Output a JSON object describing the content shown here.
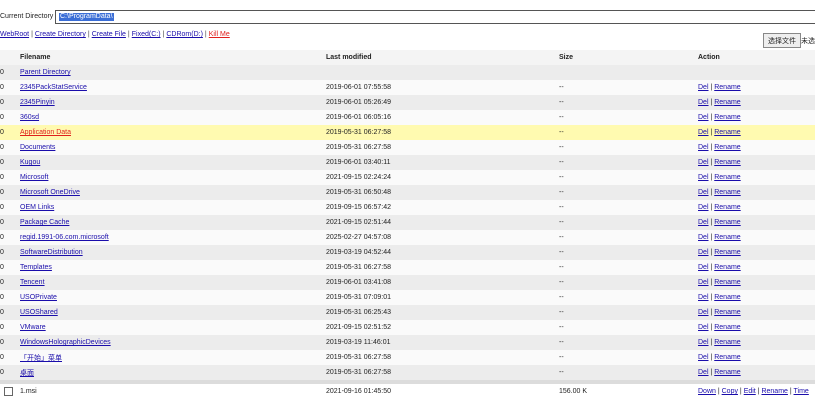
{
  "header": {
    "current_dir_label": "Current Directory :",
    "current_dir_value": "C:\\ProgramData\\"
  },
  "toolbar": {
    "webroot": "WebRoot",
    "create_directory": "Create Directory",
    "create_file": "Create File",
    "fixed_c": "Fixed(C:)",
    "cdrom_d": "CDRom(D:)",
    "kill_me": "Kill Me"
  },
  "upload": {
    "choose_file_label": "选择文件",
    "no_file_label": "未选"
  },
  "table": {
    "headers": [
      "Filename",
      "Last modified",
      "Size",
      "Action"
    ],
    "parent_row": {
      "col0": "0",
      "name": "Parent Directory"
    },
    "dir_rows": [
      {
        "col0": "0",
        "name": "2345PackStatService",
        "modified": "2019-06-01 07:55:58",
        "size": "--",
        "del": "Del",
        "rename": "Rename"
      },
      {
        "col0": "0",
        "name": "2345Pinyin",
        "modified": "2019-06-01 05:26:49",
        "size": "--",
        "del": "Del",
        "rename": "Rename"
      },
      {
        "col0": "0",
        "name": "360sd",
        "modified": "2019-06-01 06:05:16",
        "size": "--",
        "del": "Del",
        "rename": "Rename"
      },
      {
        "col0": "0",
        "name": "Application Data",
        "modified": "2019-05-31 06:27:58",
        "size": "--",
        "del": "Del",
        "rename": "Rename"
      },
      {
        "col0": "0",
        "name": "Documents",
        "modified": "2019-05-31 06:27:58",
        "size": "--",
        "del": "Del",
        "rename": "Rename"
      },
      {
        "col0": "0",
        "name": "Kugou",
        "modified": "2019-06-01 03:40:11",
        "size": "--",
        "del": "Del",
        "rename": "Rename"
      },
      {
        "col0": "0",
        "name": "Microsoft",
        "modified": "2021-09-15 02:24:24",
        "size": "--",
        "del": "Del",
        "rename": "Rename"
      },
      {
        "col0": "0",
        "name": "Microsoft OneDrive",
        "modified": "2019-05-31 06:50:48",
        "size": "--",
        "del": "Del",
        "rename": "Rename"
      },
      {
        "col0": "0",
        "name": "OEM Links",
        "modified": "2019-09-15 06:57:42",
        "size": "--",
        "del": "Del",
        "rename": "Rename"
      },
      {
        "col0": "0",
        "name": "Package Cache",
        "modified": "2021-09-15 02:51:44",
        "size": "--",
        "del": "Del",
        "rename": "Rename"
      },
      {
        "col0": "0",
        "name": "regid.1991-06.com.microsoft",
        "modified": "2025-02-27 04:57:08",
        "size": "--",
        "del": "Del",
        "rename": "Rename"
      },
      {
        "col0": "0",
        "name": "SoftwareDistribution",
        "modified": "2019-03-19 04:52:44",
        "size": "--",
        "del": "Del",
        "rename": "Rename"
      },
      {
        "col0": "0",
        "name": "Templates",
        "modified": "2019-05-31 06:27:58",
        "size": "--",
        "del": "Del",
        "rename": "Rename"
      },
      {
        "col0": "0",
        "name": "Tencent",
        "modified": "2019-06-01 03:41:08",
        "size": "--",
        "del": "Del",
        "rename": "Rename"
      },
      {
        "col0": "0",
        "name": "USOPrivate",
        "modified": "2019-05-31 07:09:01",
        "size": "--",
        "del": "Del",
        "rename": "Rename"
      },
      {
        "col0": "0",
        "name": "USOShared",
        "modified": "2019-05-31 06:25:43",
        "size": "--",
        "del": "Del",
        "rename": "Rename"
      },
      {
        "col0": "0",
        "name": "VMware",
        "modified": "2021-09-15 02:51:52",
        "size": "--",
        "del": "Del",
        "rename": "Rename"
      },
      {
        "col0": "0",
        "name": "WindowsHolographicDevices",
        "modified": "2019-03-19 11:46:01",
        "size": "--",
        "del": "Del",
        "rename": "Rename"
      },
      {
        "col0": "0",
        "name": "「开始」菜单",
        "modified": "2019-05-31 06:27:58",
        "size": "--",
        "del": "Del",
        "rename": "Rename"
      },
      {
        "col0": "0",
        "name": "桌面",
        "modified": "2019-05-31 06:27:58",
        "size": "--",
        "del": "Del",
        "rename": "Rename"
      }
    ],
    "file_row": {
      "name": "1.msi",
      "modified": "2021-09-16 01:45:50",
      "size": "156.00 K",
      "down": "Down",
      "copy": "Copy",
      "edit": "Edit",
      "rename": "Rename",
      "time": "Time"
    },
    "sep": "|"
  },
  "colors": {
    "highlight_row": "#fffab0",
    "link": "#1a0dab",
    "kill_me": "#e0201d",
    "selection": "#3b6ed6"
  }
}
